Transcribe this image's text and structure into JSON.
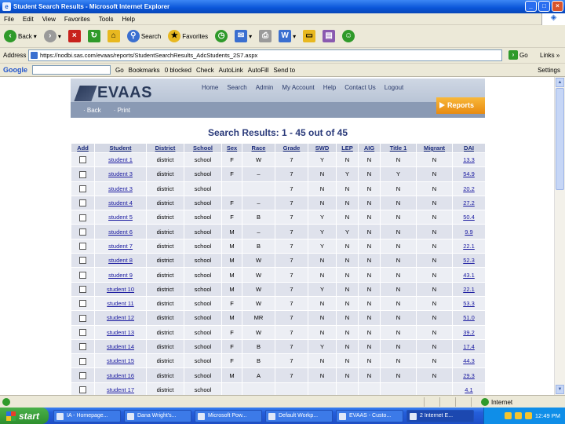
{
  "window": {
    "title": "Student Search Results - Microsoft Internet Explorer"
  },
  "menu": [
    "File",
    "Edit",
    "View",
    "Favorites",
    "Tools",
    "Help"
  ],
  "toolbar": {
    "back_label": "Back",
    "search_label": "Search",
    "favorites_label": "Favorites"
  },
  "address": {
    "label": "Address",
    "url": "https://nodbi.sas.com/evaas/reports/StudentSearchResults_AdcStudents_2S7.aspx",
    "go_label": "Go",
    "links_label": "Links"
  },
  "googlebar": {
    "logo": "Google",
    "go_label": "Go",
    "bookmarks_label": "Bookmarks",
    "blocked_label": "0 blocked",
    "check_label": "Check",
    "autolink_label": "AutoLink",
    "autofill_label": "AutoFill",
    "sendto_label": "Send to",
    "settings_label": "Settings"
  },
  "site": {
    "logo": "EVAAS",
    "nav": [
      "Home",
      "Search",
      "Admin",
      "My Account",
      "Help",
      "Contact Us",
      "Logout"
    ],
    "subnav": [
      "Back",
      "Print"
    ],
    "reports_label": "Reports"
  },
  "results": {
    "heading": "Search Results: 1 - 45 out of 45",
    "columns": [
      "Add",
      "Student",
      "District",
      "School",
      "Sex",
      "Race",
      "Grade",
      "SWD",
      "LEP",
      "AIG",
      "Title 1",
      "Migrant",
      "DAI"
    ],
    "rows": [
      {
        "student": "student 1",
        "district": "district",
        "school": "school",
        "sex": "F",
        "race": "W",
        "grade": "7",
        "swd": "Y",
        "lep": "N",
        "aig": "N",
        "title1": "N",
        "migrant": "N",
        "dai": "13.3"
      },
      {
        "student": "student 3",
        "district": "district",
        "school": "school",
        "sex": "F",
        "race": "–",
        "grade": "7",
        "swd": "N",
        "lep": "Y",
        "aig": "N",
        "title1": "Y",
        "migrant": "N",
        "dai": "54.9"
      },
      {
        "student": "student 3",
        "district": "district",
        "school": "school",
        "sex": "",
        "race": "",
        "grade": "7",
        "swd": "N",
        "lep": "N",
        "aig": "N",
        "title1": "N",
        "migrant": "N",
        "dai": "20.2"
      },
      {
        "student": "student 4",
        "district": "district",
        "school": "school",
        "sex": "F",
        "race": "–",
        "grade": "7",
        "swd": "N",
        "lep": "N",
        "aig": "N",
        "title1": "N",
        "migrant": "N",
        "dai": "27.2"
      },
      {
        "student": "student 5",
        "district": "district",
        "school": "school",
        "sex": "F",
        "race": "B",
        "grade": "7",
        "swd": "Y",
        "lep": "N",
        "aig": "N",
        "title1": "N",
        "migrant": "N",
        "dai": "50.4"
      },
      {
        "student": "student 6",
        "district": "district",
        "school": "school",
        "sex": "M",
        "race": "–",
        "grade": "7",
        "swd": "Y",
        "lep": "Y",
        "aig": "N",
        "title1": "N",
        "migrant": "N",
        "dai": "9.9"
      },
      {
        "student": "student 7",
        "district": "district",
        "school": "school",
        "sex": "M",
        "race": "B",
        "grade": "7",
        "swd": "Y",
        "lep": "N",
        "aig": "N",
        "title1": "N",
        "migrant": "N",
        "dai": "22.1"
      },
      {
        "student": "student 8",
        "district": "district",
        "school": "school",
        "sex": "M",
        "race": "W",
        "grade": "7",
        "swd": "N",
        "lep": "N",
        "aig": "N",
        "title1": "N",
        "migrant": "N",
        "dai": "52.3"
      },
      {
        "student": "student 9",
        "district": "district",
        "school": "school",
        "sex": "M",
        "race": "W",
        "grade": "7",
        "swd": "N",
        "lep": "N",
        "aig": "N",
        "title1": "N",
        "migrant": "N",
        "dai": "43.1"
      },
      {
        "student": "student 10",
        "district": "district",
        "school": "school",
        "sex": "M",
        "race": "W",
        "grade": "7",
        "swd": "Y",
        "lep": "N",
        "aig": "N",
        "title1": "N",
        "migrant": "N",
        "dai": "22.1"
      },
      {
        "student": "student 11",
        "district": "district",
        "school": "school",
        "sex": "F",
        "race": "W",
        "grade": "7",
        "swd": "N",
        "lep": "N",
        "aig": "N",
        "title1": "N",
        "migrant": "N",
        "dai": "53.3"
      },
      {
        "student": "student 12",
        "district": "district",
        "school": "school",
        "sex": "M",
        "race": "MR",
        "grade": "7",
        "swd": "N",
        "lep": "N",
        "aig": "N",
        "title1": "N",
        "migrant": "N",
        "dai": "51.0"
      },
      {
        "student": "student 13",
        "district": "district",
        "school": "school",
        "sex": "F",
        "race": "W",
        "grade": "7",
        "swd": "N",
        "lep": "N",
        "aig": "N",
        "title1": "N",
        "migrant": "N",
        "dai": "39.2"
      },
      {
        "student": "student 14",
        "district": "district",
        "school": "school",
        "sex": "F",
        "race": "B",
        "grade": "7",
        "swd": "Y",
        "lep": "N",
        "aig": "N",
        "title1": "N",
        "migrant": "N",
        "dai": "17.4"
      },
      {
        "student": "student 15",
        "district": "district",
        "school": "school",
        "sex": "F",
        "race": "B",
        "grade": "7",
        "swd": "N",
        "lep": "N",
        "aig": "N",
        "title1": "N",
        "migrant": "N",
        "dai": "44.3"
      },
      {
        "student": "student 16",
        "district": "district",
        "school": "school",
        "sex": "M",
        "race": "A",
        "grade": "7",
        "swd": "N",
        "lep": "N",
        "aig": "N",
        "title1": "N",
        "migrant": "N",
        "dai": "29.3"
      },
      {
        "student": "student 17",
        "district": "district",
        "school": "school",
        "sex": "",
        "race": "",
        "grade": "",
        "swd": "",
        "lep": "",
        "aig": "",
        "title1": "",
        "migrant": "",
        "dai": "4.1"
      }
    ]
  },
  "status": {
    "zone": "Internet"
  },
  "taskbar": {
    "start": "start",
    "tasks": [
      "IA - Homepage...",
      "Dana Wright's...",
      "Microsoft Pow...",
      "Default Workp...",
      "EVAAS - Custo...",
      "2 Internet E..."
    ],
    "clock": "12:49 PM"
  },
  "colors": {
    "title_blue": "#0a55d8",
    "heading": "#2a3a7a",
    "reports_orange": "#f0a020",
    "banner": "#aab8cc"
  }
}
